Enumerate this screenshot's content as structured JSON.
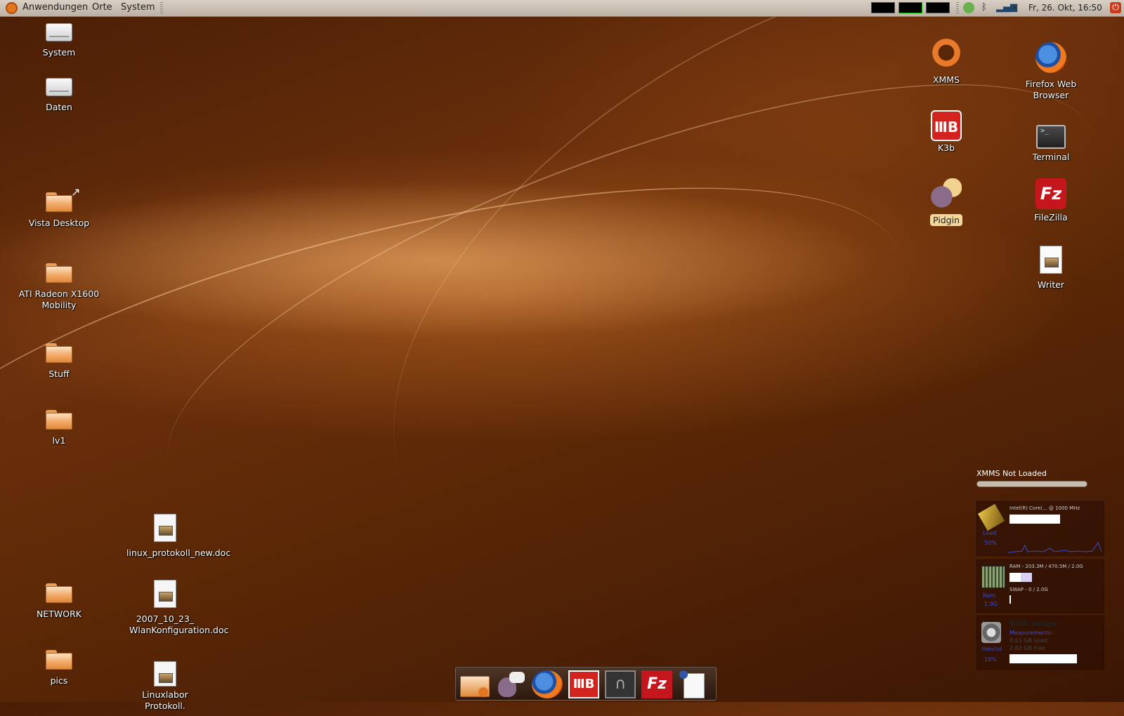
{
  "panel": {
    "menus": [
      "Anwendungen",
      "Orte",
      "System"
    ],
    "clock": "Fr, 26. Okt, 16:50"
  },
  "desktop_left": {
    "system": "System",
    "daten": "Daten",
    "vista": "Vista Desktop",
    "ati": "ATI Radeon X1600 Mobility",
    "stuff": "Stuff",
    "lv1": "lv1",
    "network": "NETWORK",
    "pics": "pics"
  },
  "desktop_docs": {
    "doc1": "linux_protokoll_new.doc",
    "doc2": "2007_10_23_ WlanKonfiguration.doc",
    "doc3": "Linuxlabor Protokoll."
  },
  "desktop_right": {
    "xmms": "XMMS",
    "firefox": "Firefox Web Browser",
    "k3b": "K3b",
    "terminal": "Terminal",
    "pidgin": "Pidgin",
    "filezilla": "FileZilla",
    "writer": "Writer"
  },
  "conky": {
    "xmms_status": "XMMS Not Loaded",
    "cpu_name": "Intel(R) Core(... @ 1000 MHz",
    "cpu_label": "Load",
    "cpu_value": "50%",
    "ram_line": "RAM - 203.3M / 470.5M / 2.0G",
    "swap_line": "SWAP - 0 / 2.0G",
    "ram_label": "Ram",
    "ram_value": "1.9G",
    "disk_title": "Disk usage",
    "disk_sub": "Measurements:",
    "disk_used": "8.61 GB used",
    "disk_free": "2.82 GB free",
    "disk_label": "/dev/sd",
    "disk_value": "10%"
  }
}
